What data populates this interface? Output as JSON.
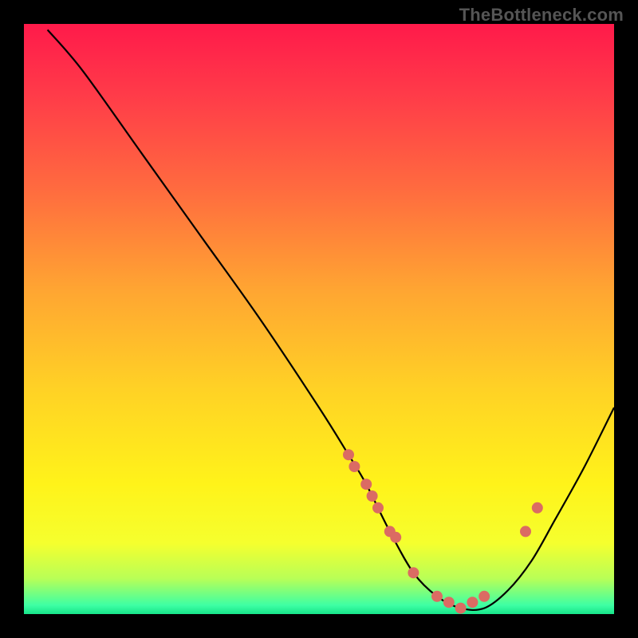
{
  "watermark": "TheBottleneck.com",
  "gradient": {
    "stops": [
      {
        "offset": 0.0,
        "color": "#ff1a4a"
      },
      {
        "offset": 0.12,
        "color": "#ff3b49"
      },
      {
        "offset": 0.28,
        "color": "#ff6b3f"
      },
      {
        "offset": 0.45,
        "color": "#ffa532"
      },
      {
        "offset": 0.62,
        "color": "#ffd225"
      },
      {
        "offset": 0.78,
        "color": "#fff31a"
      },
      {
        "offset": 0.88,
        "color": "#f5ff2e"
      },
      {
        "offset": 0.94,
        "color": "#b8ff57"
      },
      {
        "offset": 0.985,
        "color": "#3effa4"
      },
      {
        "offset": 1.0,
        "color": "#17e58a"
      }
    ]
  },
  "chart_data": {
    "type": "line",
    "title": "",
    "xlabel": "",
    "ylabel": "",
    "xlim": [
      0,
      100
    ],
    "ylim": [
      0,
      100
    ],
    "x": [
      4,
      10,
      20,
      30,
      40,
      50,
      55,
      58,
      62,
      66,
      70,
      74,
      78,
      82,
      86,
      90,
      95,
      100
    ],
    "values": [
      99,
      92,
      78,
      64,
      50,
      35,
      27,
      22,
      14,
      7,
      3,
      1,
      1,
      4,
      9,
      16,
      25,
      35
    ],
    "markers_x": [
      55,
      56,
      58,
      59,
      60,
      62,
      63,
      66,
      70,
      72,
      74,
      76,
      78,
      85,
      87
    ],
    "markers_y": [
      27,
      25,
      22,
      20,
      18,
      14,
      13,
      7,
      3,
      2,
      1,
      2,
      3,
      14,
      18
    ]
  }
}
